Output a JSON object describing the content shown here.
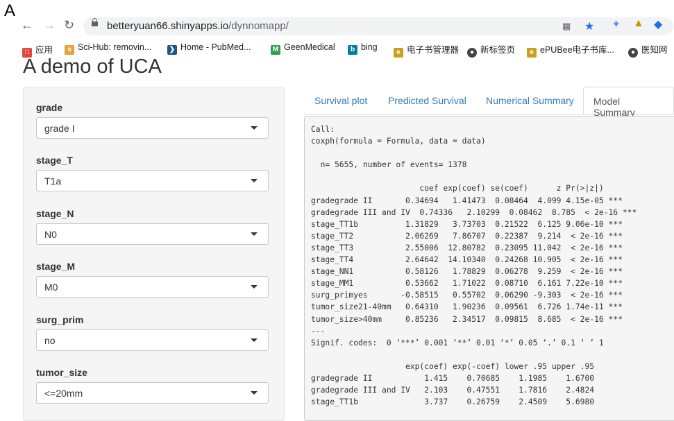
{
  "figure_label": "A",
  "browser": {
    "url_host": "betteryuan66.shinyapps.io",
    "url_path": "/dynnomapp/"
  },
  "bookmarks": [
    {
      "label": "应用",
      "icon": "apps-grid-icon",
      "color": "#e8453c"
    },
    {
      "label": "Sci-Hub: removin...",
      "icon": "scihub-icon",
      "color": "#e6a23c"
    },
    {
      "label": "Home - PubMed...",
      "icon": "pubmed-icon",
      "color": "#20558a"
    },
    {
      "label": "GeenMedical",
      "icon": "geenmedical-icon",
      "color": "#2e9e4f"
    },
    {
      "label": "bing",
      "icon": "bing-icon",
      "color": "#00809d"
    },
    {
      "label": "电子书管理器",
      "icon": "ebook-icon",
      "color": "#c9a21b"
    },
    {
      "label": "新标签页",
      "icon": "newtab-icon",
      "color": "#444444"
    },
    {
      "label": "ePUBee电子书库...",
      "icon": "epubee-icon",
      "color": "#c9a21b"
    },
    {
      "label": "医知网",
      "icon": "globe-icon",
      "color": "#444444"
    }
  ],
  "page": {
    "title": "A demo of UCA"
  },
  "inputs": [
    {
      "label": "grade",
      "value": "grade I"
    },
    {
      "label": "stage_T",
      "value": "T1a"
    },
    {
      "label": "stage_N",
      "value": "N0"
    },
    {
      "label": "stage_M",
      "value": "M0"
    },
    {
      "label": "surg_prim",
      "value": "no"
    },
    {
      "label": "tumor_size",
      "value": "<=20mm"
    }
  ],
  "tabs": [
    {
      "label": "Survival plot",
      "active": false
    },
    {
      "label": "Predicted Survival",
      "active": false
    },
    {
      "label": "Numerical Summary",
      "active": false
    },
    {
      "label": "Model Summary",
      "active": true
    }
  ],
  "model_summary": {
    "lines": [
      "Call:",
      "coxph(formula = Formula, data = data)",
      "",
      "  n= 5655, number of events= 1378",
      "",
      "                       coef exp(coef) se(coef)      z Pr(>|z|)",
      "gradegrade II       0.34694   1.41473  0.08464  4.099 4.15e-05 ***",
      "gradegrade III and IV  0.74336   2.10299  0.08462  8.785  < 2e-16 ***",
      "stage_TT1b          1.31829   3.73703  0.21522  6.125 9.06e-10 ***",
      "stage_TT2           2.06269   7.86707  0.22387  9.214  < 2e-16 ***",
      "stage_TT3           2.55006  12.80782  0.23095 11.042  < 2e-16 ***",
      "stage_TT4           2.64642  14.10340  0.24268 10.905  < 2e-16 ***",
      "stage_NN1           0.58126   1.78829  0.06278  9.259  < 2e-16 ***",
      "stage_MM1           0.53662   1.71022  0.08710  6.161 7.22e-10 ***",
      "surg_primyes       -0.58515   0.55702  0.06290 -9.303  < 2e-16 ***",
      "tumor_size21-40mm   0.64310   1.90236  0.09561  6.726 1.74e-11 ***",
      "tumor_size>40mm     0.85236   2.34517  0.09815  8.685  < 2e-16 ***",
      "---",
      "Signif. codes:  0 ‘***’ 0.001 ‘**’ 0.01 ‘*’ 0.05 ‘.’ 0.1 ‘ ’ 1",
      "",
      "                    exp(coef) exp(-coef) lower .95 upper .95",
      "gradegrade II           1.415    0.70685    1.1985    1.6700",
      "gradegrade III and IV   2.103    0.47551    1.7816    2.4824",
      "stage_TT1b              3.737    0.26759    2.4509    5.6980"
    ]
  }
}
